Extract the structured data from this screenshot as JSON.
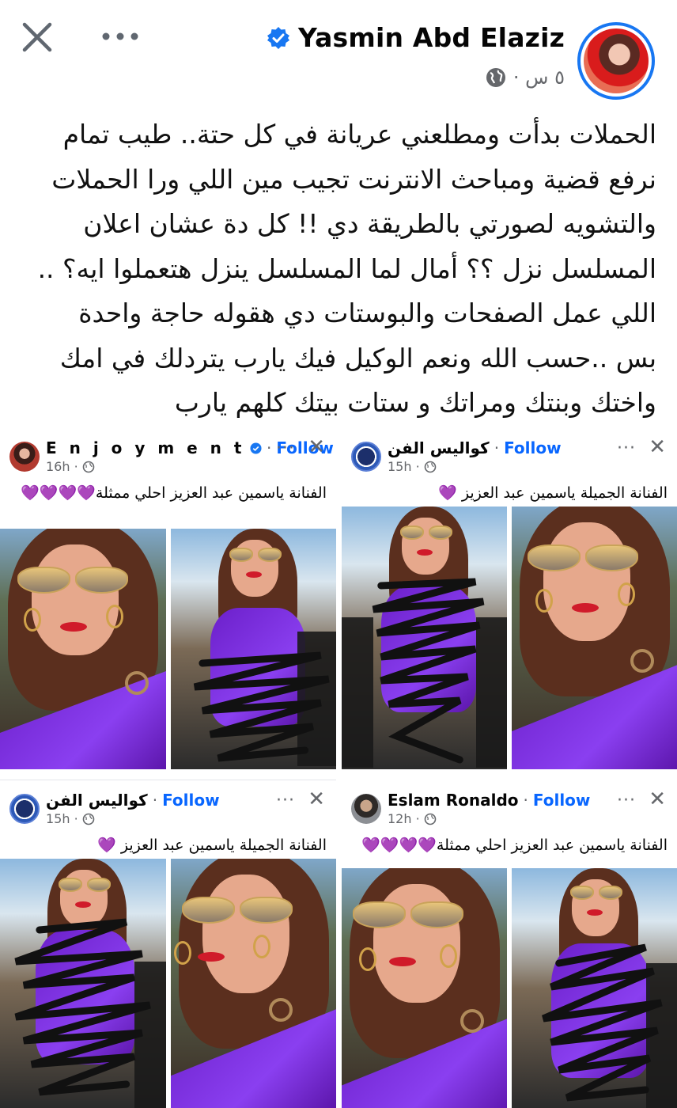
{
  "header": {
    "author": "Yasmin Abd Elaziz",
    "time": "٥ س ·",
    "close_icon": "close-icon",
    "more_icon": "more-horizontal-icon"
  },
  "post": {
    "lines": [
      "الحملات بدأت  ومطلعني عريانة في كل حتة.. طيب تمام",
      "نرفع قضية ومباحث الانترنت تجيب مين اللي ورا الحملات",
      "والتشويه لصورتي بالطريقة دي !! كل دة عشان اعلان",
      "المسلسل نزل ؟؟ أمال لما  المسلسل  ينزل هتعملوا ايه؟ ..",
      "اللي عمل الصفحات والبوستات دي هقوله حاجة واحدة",
      "بس ..حسب الله ونعم الوكيل فيك يارب يتردلك في امك",
      "واختك وبنتك ومراتك و ستات بيتك كلهم يارب"
    ]
  },
  "cards": [
    {
      "name": "E n j o y m e n t",
      "follow": "Follow",
      "dot": "·",
      "time": "16h ·",
      "caption": "الفنانة ياسمين عبد العزيز احلي ممثلة💜💜💜💜",
      "dots": "···",
      "close": "✕"
    },
    {
      "name": "كواليس الفن",
      "follow": "Follow",
      "dot": "·",
      "time": "15h ·",
      "caption": "الفنانة الجميلة ياسمين عبد العزيز 💜",
      "dots": "···",
      "close": "✕"
    },
    {
      "name": "كواليس الفن",
      "follow": "Follow",
      "dot": "·",
      "time": "15h ·",
      "caption": "الفنانة الجميلة ياسمين عبد العزيز 💜",
      "dots": "···",
      "close": "✕"
    },
    {
      "name": "Eslam Ronaldo",
      "follow": "Follow",
      "dot": "·",
      "time": "12h ·",
      "caption": "الفنانة ياسمين عبد العزيز احلي ممثلة💜💜💜💜",
      "dots": "···",
      "close": "✕"
    }
  ],
  "colors": {
    "accent": "#1877f2",
    "follow": "#0866ff",
    "secondary_text": "#65676b",
    "swimsuit": "#7a2fe0"
  }
}
